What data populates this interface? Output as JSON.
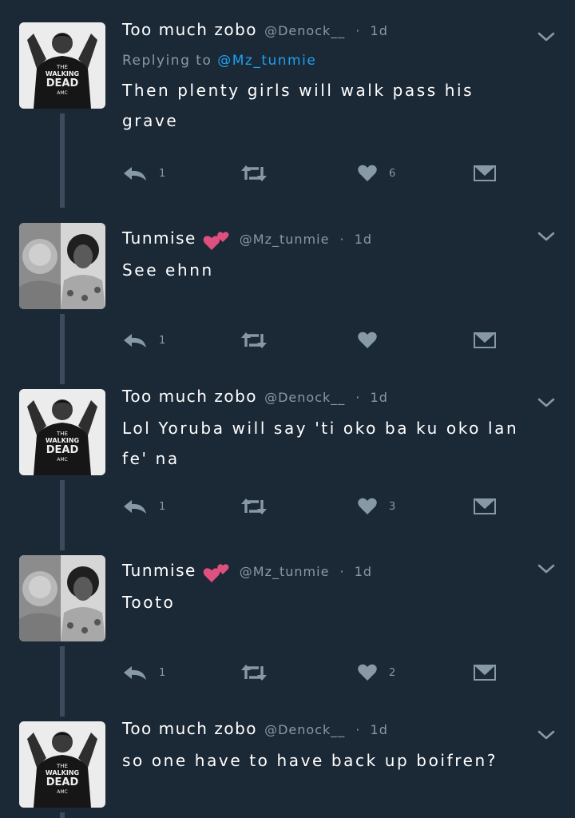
{
  "tweets": [
    {
      "author": "Too much zobo",
      "handle": "@Denock__",
      "separator": "·",
      "time": "1d",
      "reply_label": "Replying to",
      "reply_mention": "@Mz_tunmie",
      "text": "Then plenty girls will walk pass his grave",
      "reply_count": "1",
      "like_count": "6",
      "avatar": "walking-dead-shirt-avatar"
    },
    {
      "author": "Tunmise",
      "handle": "@Mz_tunmie",
      "separator": "·",
      "time": "1d",
      "text": "See ehnn",
      "reply_count": "1",
      "like_count": "",
      "avatar": "split-portrait-avatar"
    },
    {
      "author": "Too much zobo",
      "handle": "@Denock__",
      "separator": "·",
      "time": "1d",
      "text": "Lol Yoruba will say 'ti oko ba ku oko lan fe' na",
      "reply_count": "1",
      "like_count": "3",
      "avatar": "walking-dead-shirt-avatar"
    },
    {
      "author": "Tunmise",
      "handle": "@Mz_tunmie",
      "separator": "·",
      "time": "1d",
      "text": "Tooto",
      "reply_count": "1",
      "like_count": "2",
      "avatar": "split-portrait-avatar"
    },
    {
      "author": "Too much zobo",
      "handle": "@Denock__",
      "separator": "·",
      "time": "1d",
      "text": "so one have to have back up boifren?",
      "avatar": "walking-dead-shirt-avatar"
    }
  ],
  "avatar_shirt_text": [
    "THE",
    "WALKING",
    "DEAD",
    "AMC"
  ],
  "colors": {
    "background": "#1b2836",
    "name": "#ffffff",
    "secondary": "#8899a6",
    "mention": "#1da1f2",
    "action_icon": "#8899a6",
    "hearts_emoji": "#e0507f",
    "thread_line": "#3c4c5c"
  },
  "icons": {
    "reply": "reply-arrow-icon",
    "retweet": "retweet-icon",
    "like": "heart-icon",
    "dm": "envelope-icon",
    "more": "chevron-down-icon",
    "name_emoji": "two-hearts-emoji"
  }
}
